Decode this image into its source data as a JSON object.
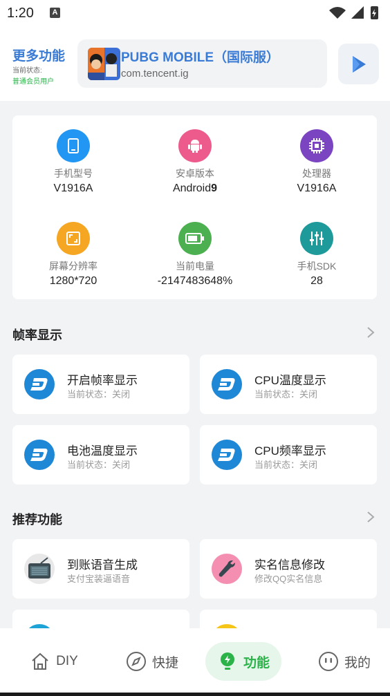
{
  "status_bar": {
    "time": "1:20",
    "notification_badge": "A"
  },
  "header": {
    "title": "更多功能",
    "status_label": "当前状态:",
    "status_value": "普通会员用户",
    "app_name": "PUBG MOBILE（国际服）",
    "app_package": "com.tencent.ig"
  },
  "device_info": [
    {
      "icon": "phone-icon",
      "color": "#2196f3",
      "label": "手机型号",
      "value": "V1916A"
    },
    {
      "icon": "android-icon",
      "color": "#ec5b8b",
      "label": "安卓版本",
      "value": "Android",
      "value_bold": "9"
    },
    {
      "icon": "cpu-icon",
      "color": "#7b45c2",
      "label": "处理器",
      "value": "V1916A"
    },
    {
      "icon": "screen-icon",
      "color": "#f5a623",
      "label": "屏幕分辨率",
      "value": "1280*720"
    },
    {
      "icon": "battery-icon",
      "color": "#4caf50",
      "label": "当前电量",
      "value": "-2147483648%"
    },
    {
      "icon": "sliders-icon",
      "color": "#1e9a9a",
      "label": "手机SDK",
      "value": "28"
    }
  ],
  "fps_section": {
    "title": "帧率显示",
    "items": [
      {
        "title": "开启帧率显示",
        "subtitle": "当前状态：关闭",
        "icon": "dash-icon"
      },
      {
        "title": "CPU温度显示",
        "subtitle": "当前状态：关闭",
        "icon": "dash-icon"
      },
      {
        "title": "电池温度显示",
        "subtitle": "当前状态：关闭",
        "icon": "dash-icon"
      },
      {
        "title": "CPU频率显示",
        "subtitle": "当前状态：关闭",
        "icon": "dash-icon"
      }
    ]
  },
  "recommend_section": {
    "title": "推荐功能",
    "items": [
      {
        "title": "到账语音生成",
        "subtitle": "支付宝装逼语音",
        "icon": "radio-icon"
      },
      {
        "title": "实名信息修改",
        "subtitle": "修改QQ实名信息",
        "icon": "wrench-icon"
      }
    ]
  },
  "bottom_nav": [
    {
      "label": "DIY",
      "icon": "home-icon"
    },
    {
      "label": "快捷",
      "icon": "compass-icon"
    },
    {
      "label": "功能",
      "icon": "bulb-icon",
      "active": true
    },
    {
      "label": "我的",
      "icon": "face-icon"
    }
  ],
  "colors": {
    "accent_blue": "#3a7bd5",
    "accent_green": "#2bb34a",
    "dash_blue": "#1e88d6"
  }
}
